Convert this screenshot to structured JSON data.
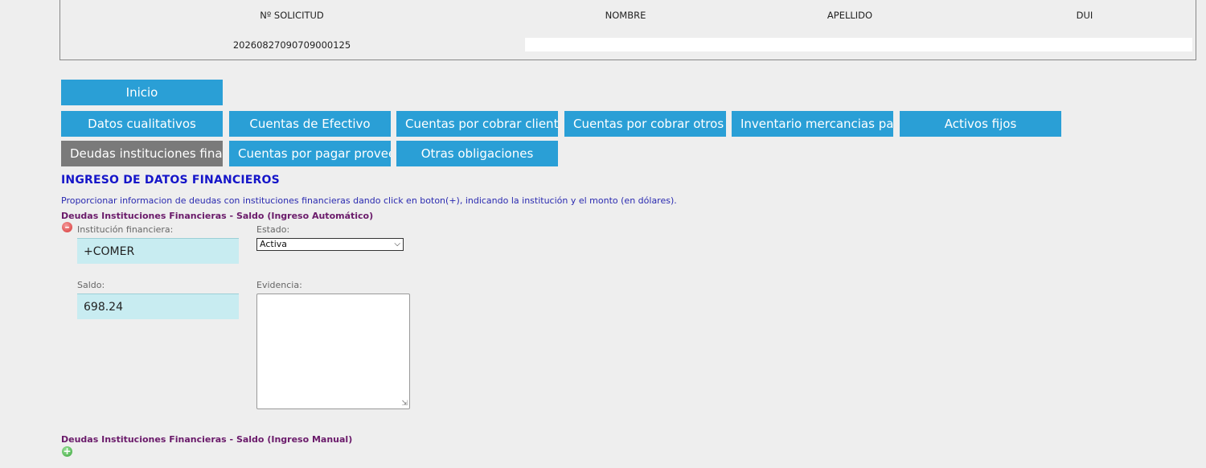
{
  "header": {
    "col_solicitud": "Nº SOLICITUD",
    "col_nombre": "NOMBRE",
    "col_apellido": "APELLIDO",
    "col_dui": "DUI",
    "solicitud_value": "20260827090709000125"
  },
  "tabs": {
    "inicio": "Inicio",
    "datos_cualitativos": "Datos cualitativos",
    "cuentas_efectivo": "Cuentas de Efectivo",
    "cuentas_cobrar_clientes": "Cuentas por cobrar clientes",
    "cuentas_cobrar_otros": "Cuentas por cobrar otros",
    "inventario": "Inventario mercancias para la venta",
    "activos_fijos": "Activos fijos",
    "deudas_instituciones": "Deudas instituciones financieras",
    "cuentas_pagar_proveedores": "Cuentas por pagar proveedores",
    "otras_obligaciones": "Otras obligaciones"
  },
  "section": {
    "title": "INGRESO DE DATOS FINANCIEROS",
    "instructions": "Proporcionar informacion de deudas con instituciones financieras dando click en boton(+), indicando la institución y el monto (en dólares).",
    "auto_title": "Deudas Instituciones Financieras - Saldo (Ingreso Automático)",
    "manual_title": "Deudas Instituciones Financieras - Saldo (Ingreso Manual)"
  },
  "form": {
    "institucion_label": "Institución financiera:",
    "institucion_value": "+COMER",
    "estado_label": "Estado:",
    "estado_value": "Activa",
    "saldo_label": "Saldo:",
    "saldo_value": "698.24",
    "evidencia_label": "Evidencia:"
  },
  "icons": {
    "remove": "minus-circle-icon",
    "add": "plus-circle-icon",
    "dropdown": "chevron-down-icon"
  },
  "colors": {
    "tab_bg": "#2a9fd6",
    "tab_active_bg": "#7a7a7a",
    "title": "#1515c9",
    "subsection": "#6a1a6a",
    "input_bg": "#c8ecf1"
  }
}
